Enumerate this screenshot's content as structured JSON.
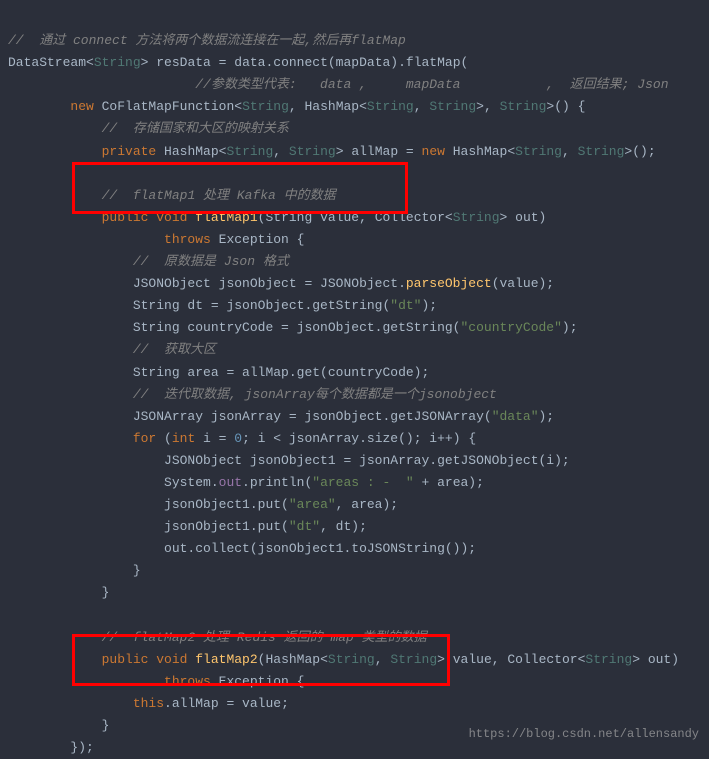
{
  "code": {
    "line1_comment": "//  通过 connect 方法将两个数据流连接在一起,然后再flatMap",
    "line2_a": "DataStream",
    "line2_b": "String",
    "line2_c": " resData = data.connect(mapData).flatMap(",
    "line3_comment": "//参数类型代表:   data ,     mapData           ,  返回结果; Json",
    "line4_a": "new",
    "line4_b": " CoFlatMapFunction",
    "line4_c": "String",
    "line4_d": ", HashMap",
    "line4_e": "String",
    "line4_f": ", ",
    "line4_g": "String",
    "line4_h": ", ",
    "line4_i": "String",
    "line4_j": "() {",
    "line5_comment": "//  存储国家和大区的映射关系",
    "line6_a": "private",
    "line6_b": " HashMap",
    "line6_c": "String",
    "line6_d": ", ",
    "line6_e": "String",
    "line6_f": " allMap = ",
    "line6_g": "new",
    "line6_h": " HashMap",
    "line6_i": "String",
    "line6_j": ", ",
    "line6_k": "String",
    "line6_l": "();",
    "line7_comment": "//  flatMap1 处理 Kafka 中的数据",
    "line8_a": "public void",
    "line8_b": " flatMap1",
    "line8_c": "(String value, Collector",
    "line8_d": "String",
    "line8_e": " out)",
    "line9_a": "throws",
    "line9_b": " Exception {",
    "line10_comment": "//  原数据是 Json 格式",
    "line11_a": "JSONObject jsonObject = JSONObject.",
    "line11_b": "parseObject",
    "line11_c": "(value);",
    "line12_a": "String dt = jsonObject.getString(",
    "line12_b": "\"dt\"",
    "line12_c": ");",
    "line13_a": "String countryCode = jsonObject.getString(",
    "line13_b": "\"countryCode\"",
    "line13_c": ");",
    "line14_comment": "//  获取大区",
    "line15_a": "String area = allMap.get(countryCode);",
    "line16_comment": "//  迭代取数据, jsonArray每个数据都是一个jsonobject",
    "line17_a": "JSONArray jsonArray = jsonObject.getJSONArray(",
    "line17_b": "\"data\"",
    "line17_c": ");",
    "line18_a": "for",
    "line18_b": " (",
    "line18_c": "int",
    "line18_d": " i = ",
    "line18_e": "0",
    "line18_f": "; i < jsonArray.size(); i++) {",
    "line19_a": "JSONObject jsonObject1 = jsonArray.getJSONObject(i);",
    "line20_a": "System.",
    "line20_b": "out",
    "line20_c": ".println(",
    "line20_d": "\"areas : -  \"",
    "line20_e": " + area);",
    "line21_a": "jsonObject1.put(",
    "line21_b": "\"area\"",
    "line21_c": ", area);",
    "line22_a": "jsonObject1.put(",
    "line22_b": "\"dt\"",
    "line22_c": ", dt);",
    "line23_a": "out.collect(jsonObject1.toJSONString());",
    "line24": "}",
    "line25": "}",
    "line26_comment": "//  flatMap2 处理 Redis 返回的 map 类型的数据",
    "line27_a": "public void",
    "line27_b": " flatMap2",
    "line27_c": "(HashMap",
    "line27_d": "String",
    "line27_e": ", ",
    "line27_f": "String",
    "line27_g": " value, Collector",
    "line27_h": "String",
    "line27_i": " out)",
    "line28_a": "throws",
    "line28_b": " Exception {",
    "line29_a": "this",
    "line29_b": ".allMap = value;",
    "line30": "}",
    "line31": "});"
  },
  "watermark": "https://blog.csdn.net/allensandy"
}
